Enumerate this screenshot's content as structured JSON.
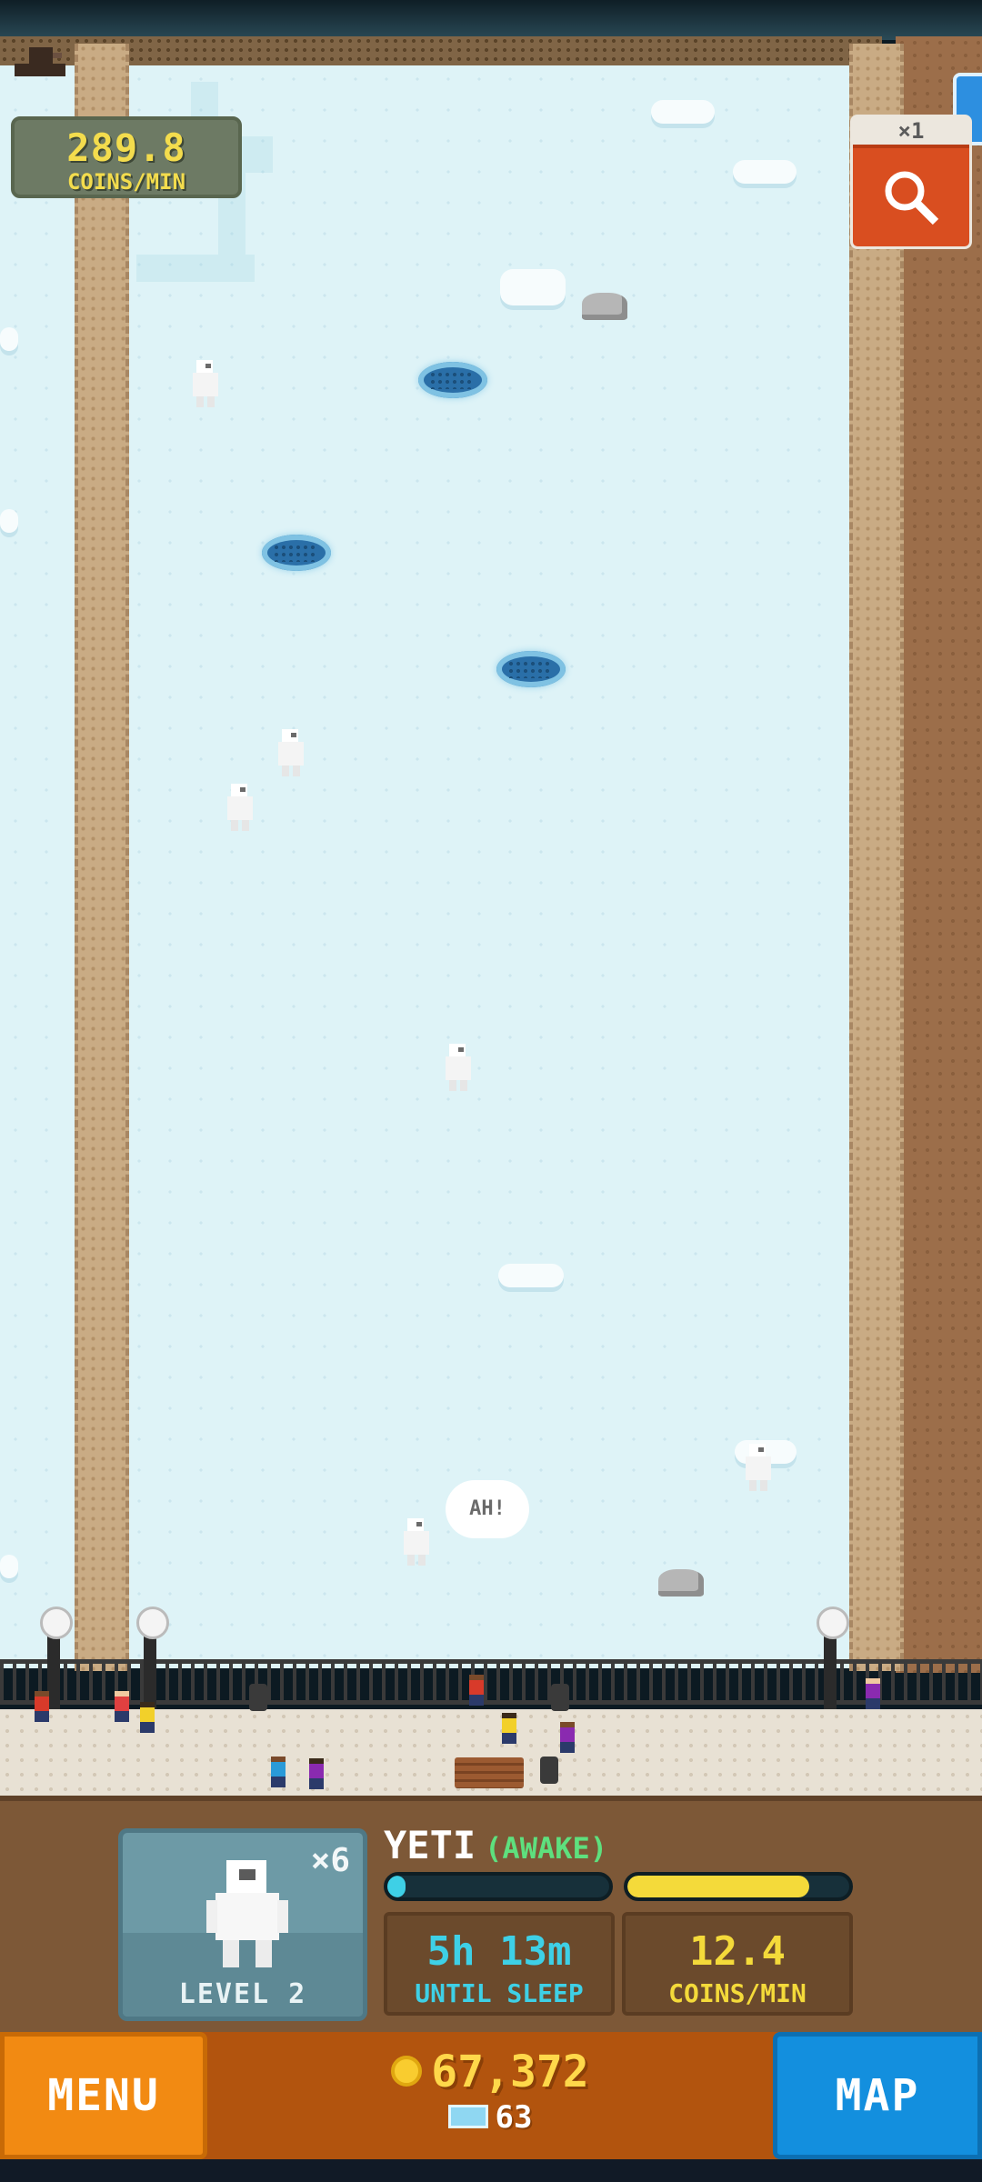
{
  "header": {
    "coins_per_min_value": "289.8",
    "coins_per_min_label": "COINS/MIN",
    "finder_multiplier": "×1"
  },
  "scene": {
    "speech_text": "AH!"
  },
  "animal_panel": {
    "card_count": "×6",
    "card_level": "LEVEL 2",
    "name": "YETI",
    "state": "(AWAKE)",
    "sleep_bar_fill": 0.08,
    "coins_bar_fill": 0.82,
    "until_sleep_value": "5h 13m",
    "until_sleep_label": "UNTIL SLEEP",
    "coins_per_min_value": "12.4",
    "coins_per_min_label": "COINS/MIN"
  },
  "nav": {
    "menu_label": "MENU",
    "map_label": "MAP",
    "coins_total": "67,372",
    "gems_total": "63"
  },
  "colors": {
    "ice": "#def3f7",
    "coin_yellow": "#ffd84a",
    "awake_green": "#5ee07e",
    "sleep_cyan": "#3ed0e6",
    "menu_orange": "#f28a12",
    "map_blue": "#138fde"
  },
  "icons": [
    "boot-icon",
    "magnifier-icon",
    "coin-icon",
    "gem-icon",
    "yeti-icon"
  ]
}
